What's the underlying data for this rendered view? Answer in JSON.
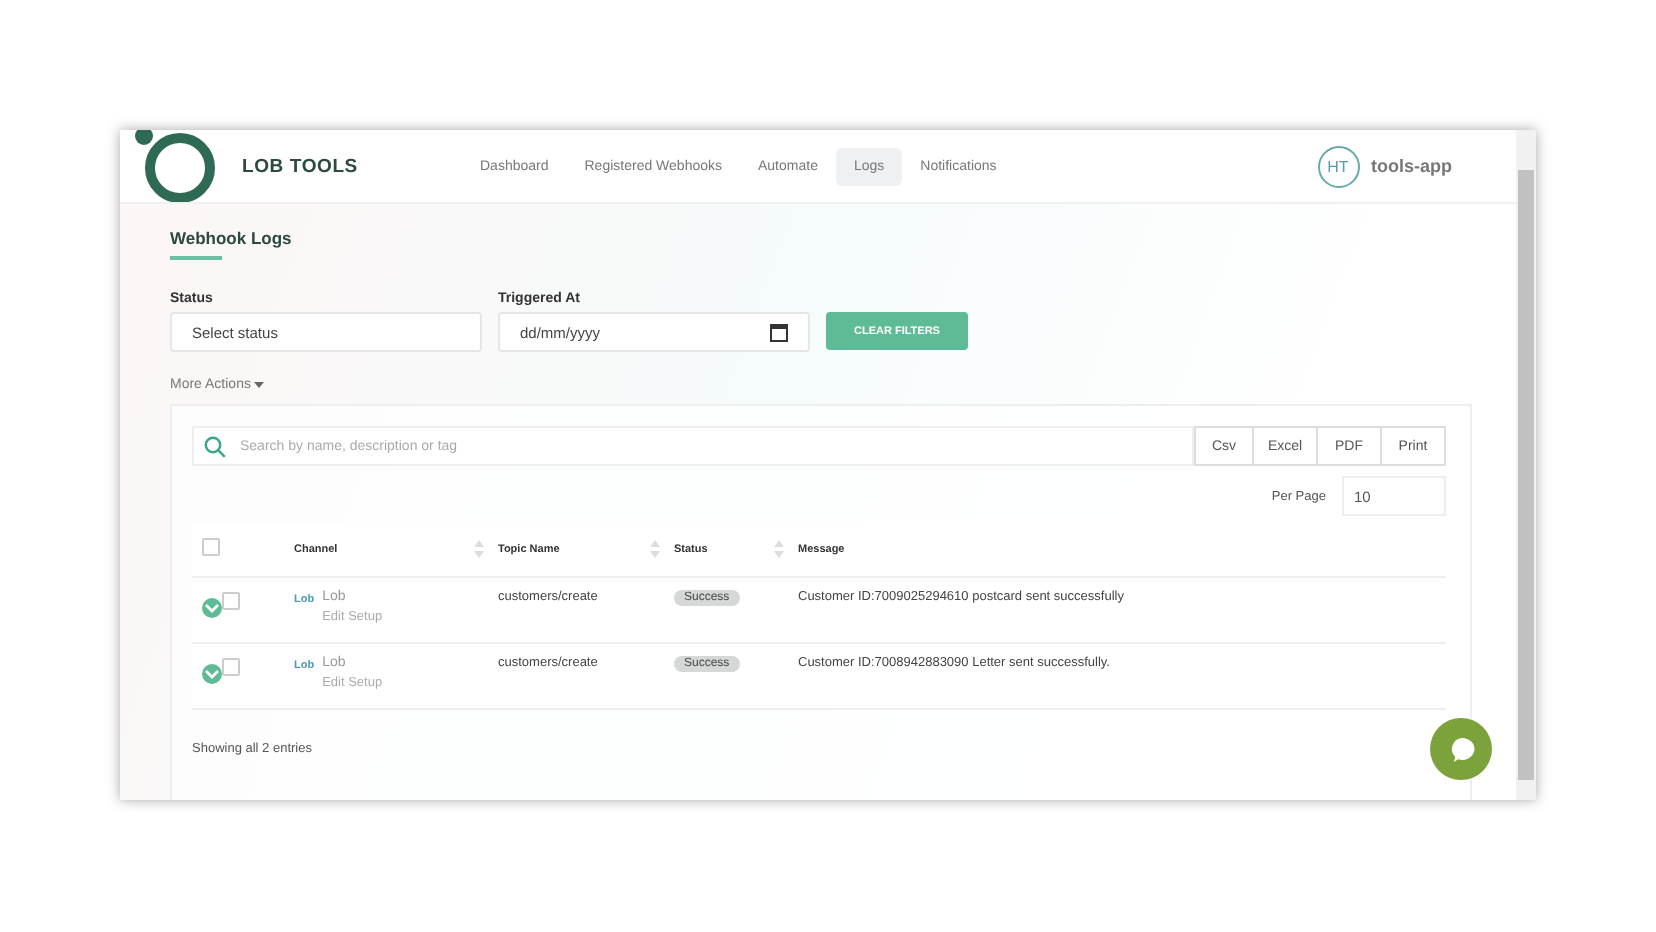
{
  "brand": {
    "name": "LOB TOOLS"
  },
  "nav": [
    {
      "label": "Dashboard",
      "selected": false
    },
    {
      "label": "Registered Webhooks",
      "selected": false
    },
    {
      "label": "Automate",
      "selected": false
    },
    {
      "label": "Logs",
      "selected": true
    },
    {
      "label": "Notifications",
      "selected": false
    }
  ],
  "user": {
    "initials": "HT",
    "name": "tools-app"
  },
  "page_title": "Webhook Logs",
  "filters": {
    "status": {
      "label": "Status",
      "value": "Select status"
    },
    "triggered_at": {
      "label": "Triggered At",
      "placeholder": "dd/mm/yyyy"
    },
    "clear_button": "CLEAR FILTERS"
  },
  "more_actions": "More Actions",
  "search": {
    "placeholder": "Search by name, description or tag"
  },
  "export_buttons": [
    "Csv",
    "Excel",
    "PDF",
    "Print"
  ],
  "per_page": {
    "label": "Per Page",
    "value": "10"
  },
  "table": {
    "select_all_checked": false,
    "columns": [
      "Channel",
      "Topic Name",
      "Status",
      "Message"
    ],
    "rows": [
      {
        "expanded": false,
        "checked": false,
        "channel_logo": "Lob",
        "channel": "Lob",
        "channel_link": "Edit Setup",
        "topic": "customers/create",
        "status": "Success",
        "message": "Customer ID:7009025294610 postcard sent successfully"
      },
      {
        "expanded": false,
        "checked": false,
        "channel_logo": "Lob",
        "channel": "Lob",
        "channel_link": "Edit Setup",
        "topic": "customers/create",
        "status": "Success",
        "message": "Customer ID:7008942883090 Letter sent successfully."
      }
    ]
  },
  "footer": "Showing all 2 entries"
}
